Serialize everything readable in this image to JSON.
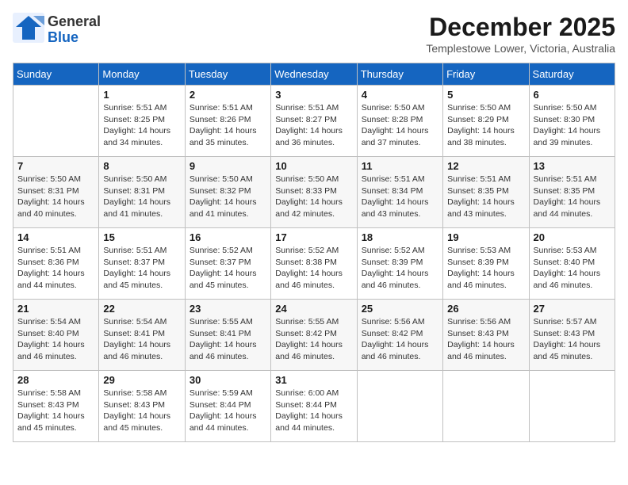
{
  "logo": {
    "line1": "General",
    "line2": "Blue"
  },
  "header": {
    "month": "December 2025",
    "location": "Templestowe Lower, Victoria, Australia"
  },
  "weekdays": [
    "Sunday",
    "Monday",
    "Tuesday",
    "Wednesday",
    "Thursday",
    "Friday",
    "Saturday"
  ],
  "weeks": [
    [
      {
        "day": "",
        "sunrise": "",
        "sunset": "",
        "daylight": ""
      },
      {
        "day": "1",
        "sunrise": "Sunrise: 5:51 AM",
        "sunset": "Sunset: 8:25 PM",
        "daylight": "Daylight: 14 hours and 34 minutes."
      },
      {
        "day": "2",
        "sunrise": "Sunrise: 5:51 AM",
        "sunset": "Sunset: 8:26 PM",
        "daylight": "Daylight: 14 hours and 35 minutes."
      },
      {
        "day": "3",
        "sunrise": "Sunrise: 5:51 AM",
        "sunset": "Sunset: 8:27 PM",
        "daylight": "Daylight: 14 hours and 36 minutes."
      },
      {
        "day": "4",
        "sunrise": "Sunrise: 5:50 AM",
        "sunset": "Sunset: 8:28 PM",
        "daylight": "Daylight: 14 hours and 37 minutes."
      },
      {
        "day": "5",
        "sunrise": "Sunrise: 5:50 AM",
        "sunset": "Sunset: 8:29 PM",
        "daylight": "Daylight: 14 hours and 38 minutes."
      },
      {
        "day": "6",
        "sunrise": "Sunrise: 5:50 AM",
        "sunset": "Sunset: 8:30 PM",
        "daylight": "Daylight: 14 hours and 39 minutes."
      }
    ],
    [
      {
        "day": "7",
        "sunrise": "Sunrise: 5:50 AM",
        "sunset": "Sunset: 8:31 PM",
        "daylight": "Daylight: 14 hours and 40 minutes."
      },
      {
        "day": "8",
        "sunrise": "Sunrise: 5:50 AM",
        "sunset": "Sunset: 8:31 PM",
        "daylight": "Daylight: 14 hours and 41 minutes."
      },
      {
        "day": "9",
        "sunrise": "Sunrise: 5:50 AM",
        "sunset": "Sunset: 8:32 PM",
        "daylight": "Daylight: 14 hours and 41 minutes."
      },
      {
        "day": "10",
        "sunrise": "Sunrise: 5:50 AM",
        "sunset": "Sunset: 8:33 PM",
        "daylight": "Daylight: 14 hours and 42 minutes."
      },
      {
        "day": "11",
        "sunrise": "Sunrise: 5:51 AM",
        "sunset": "Sunset: 8:34 PM",
        "daylight": "Daylight: 14 hours and 43 minutes."
      },
      {
        "day": "12",
        "sunrise": "Sunrise: 5:51 AM",
        "sunset": "Sunset: 8:35 PM",
        "daylight": "Daylight: 14 hours and 43 minutes."
      },
      {
        "day": "13",
        "sunrise": "Sunrise: 5:51 AM",
        "sunset": "Sunset: 8:35 PM",
        "daylight": "Daylight: 14 hours and 44 minutes."
      }
    ],
    [
      {
        "day": "14",
        "sunrise": "Sunrise: 5:51 AM",
        "sunset": "Sunset: 8:36 PM",
        "daylight": "Daylight: 14 hours and 44 minutes."
      },
      {
        "day": "15",
        "sunrise": "Sunrise: 5:51 AM",
        "sunset": "Sunset: 8:37 PM",
        "daylight": "Daylight: 14 hours and 45 minutes."
      },
      {
        "day": "16",
        "sunrise": "Sunrise: 5:52 AM",
        "sunset": "Sunset: 8:37 PM",
        "daylight": "Daylight: 14 hours and 45 minutes."
      },
      {
        "day": "17",
        "sunrise": "Sunrise: 5:52 AM",
        "sunset": "Sunset: 8:38 PM",
        "daylight": "Daylight: 14 hours and 46 minutes."
      },
      {
        "day": "18",
        "sunrise": "Sunrise: 5:52 AM",
        "sunset": "Sunset: 8:39 PM",
        "daylight": "Daylight: 14 hours and 46 minutes."
      },
      {
        "day": "19",
        "sunrise": "Sunrise: 5:53 AM",
        "sunset": "Sunset: 8:39 PM",
        "daylight": "Daylight: 14 hours and 46 minutes."
      },
      {
        "day": "20",
        "sunrise": "Sunrise: 5:53 AM",
        "sunset": "Sunset: 8:40 PM",
        "daylight": "Daylight: 14 hours and 46 minutes."
      }
    ],
    [
      {
        "day": "21",
        "sunrise": "Sunrise: 5:54 AM",
        "sunset": "Sunset: 8:40 PM",
        "daylight": "Daylight: 14 hours and 46 minutes."
      },
      {
        "day": "22",
        "sunrise": "Sunrise: 5:54 AM",
        "sunset": "Sunset: 8:41 PM",
        "daylight": "Daylight: 14 hours and 46 minutes."
      },
      {
        "day": "23",
        "sunrise": "Sunrise: 5:55 AM",
        "sunset": "Sunset: 8:41 PM",
        "daylight": "Daylight: 14 hours and 46 minutes."
      },
      {
        "day": "24",
        "sunrise": "Sunrise: 5:55 AM",
        "sunset": "Sunset: 8:42 PM",
        "daylight": "Daylight: 14 hours and 46 minutes."
      },
      {
        "day": "25",
        "sunrise": "Sunrise: 5:56 AM",
        "sunset": "Sunset: 8:42 PM",
        "daylight": "Daylight: 14 hours and 46 minutes."
      },
      {
        "day": "26",
        "sunrise": "Sunrise: 5:56 AM",
        "sunset": "Sunset: 8:43 PM",
        "daylight": "Daylight: 14 hours and 46 minutes."
      },
      {
        "day": "27",
        "sunrise": "Sunrise: 5:57 AM",
        "sunset": "Sunset: 8:43 PM",
        "daylight": "Daylight: 14 hours and 45 minutes."
      }
    ],
    [
      {
        "day": "28",
        "sunrise": "Sunrise: 5:58 AM",
        "sunset": "Sunset: 8:43 PM",
        "daylight": "Daylight: 14 hours and 45 minutes."
      },
      {
        "day": "29",
        "sunrise": "Sunrise: 5:58 AM",
        "sunset": "Sunset: 8:43 PM",
        "daylight": "Daylight: 14 hours and 45 minutes."
      },
      {
        "day": "30",
        "sunrise": "Sunrise: 5:59 AM",
        "sunset": "Sunset: 8:44 PM",
        "daylight": "Daylight: 14 hours and 44 minutes."
      },
      {
        "day": "31",
        "sunrise": "Sunrise: 6:00 AM",
        "sunset": "Sunset: 8:44 PM",
        "daylight": "Daylight: 14 hours and 44 minutes."
      },
      {
        "day": "",
        "sunrise": "",
        "sunset": "",
        "daylight": ""
      },
      {
        "day": "",
        "sunrise": "",
        "sunset": "",
        "daylight": ""
      },
      {
        "day": "",
        "sunrise": "",
        "sunset": "",
        "daylight": ""
      }
    ]
  ]
}
